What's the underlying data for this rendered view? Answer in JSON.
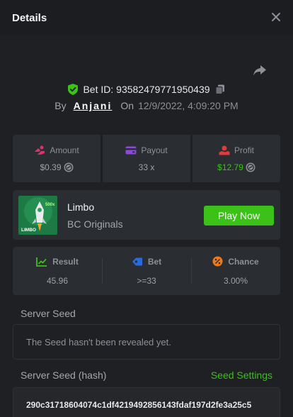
{
  "header": {
    "title": "Details"
  },
  "bet": {
    "id_label": "Bet ID: 93582479771950439",
    "by_label": "By",
    "user": "Anjani",
    "on_label": "On",
    "date": "12/9/2022, 4:09:20 PM"
  },
  "stats": {
    "amount_label": "Amount",
    "amount_value": "$0.39",
    "payout_label": "Payout",
    "payout_value": "33 x",
    "profit_label": "Profit",
    "profit_value": "$12.79"
  },
  "game": {
    "name": "Limbo",
    "provider": "BC Originals",
    "play_label": "Play Now",
    "thumb_text": "LIMBO",
    "thumb_badge": "500x"
  },
  "result": {
    "result_label": "Result",
    "result_value": "45.96",
    "bet_label": "Bet",
    "bet_value": ">=33",
    "chance_label": "Chance",
    "chance_value": "3.00%"
  },
  "seeds": {
    "server_seed_label": "Server Seed",
    "server_seed_value": "The Seed hasn't been revealed yet.",
    "server_seed_hash_label": "Server Seed (hash)",
    "seed_settings_label": "Seed Settings",
    "server_seed_hash_value": "290c31718604074c1df4219492856143fdaf197d2fe3a25c5"
  },
  "colors": {
    "accent_green": "#3bc117",
    "amount_icon": "#e0316b",
    "payout_icon": "#8a4bd8",
    "profit_icon": "#e23b3b",
    "bet_icon": "#2a6bdc",
    "chance_icon": "#f07a1a"
  },
  "icons": {
    "close": "close-icon",
    "share": "share-icon",
    "shield": "shield-check-icon",
    "copy": "copy-icon",
    "coin": "coin-icon"
  }
}
